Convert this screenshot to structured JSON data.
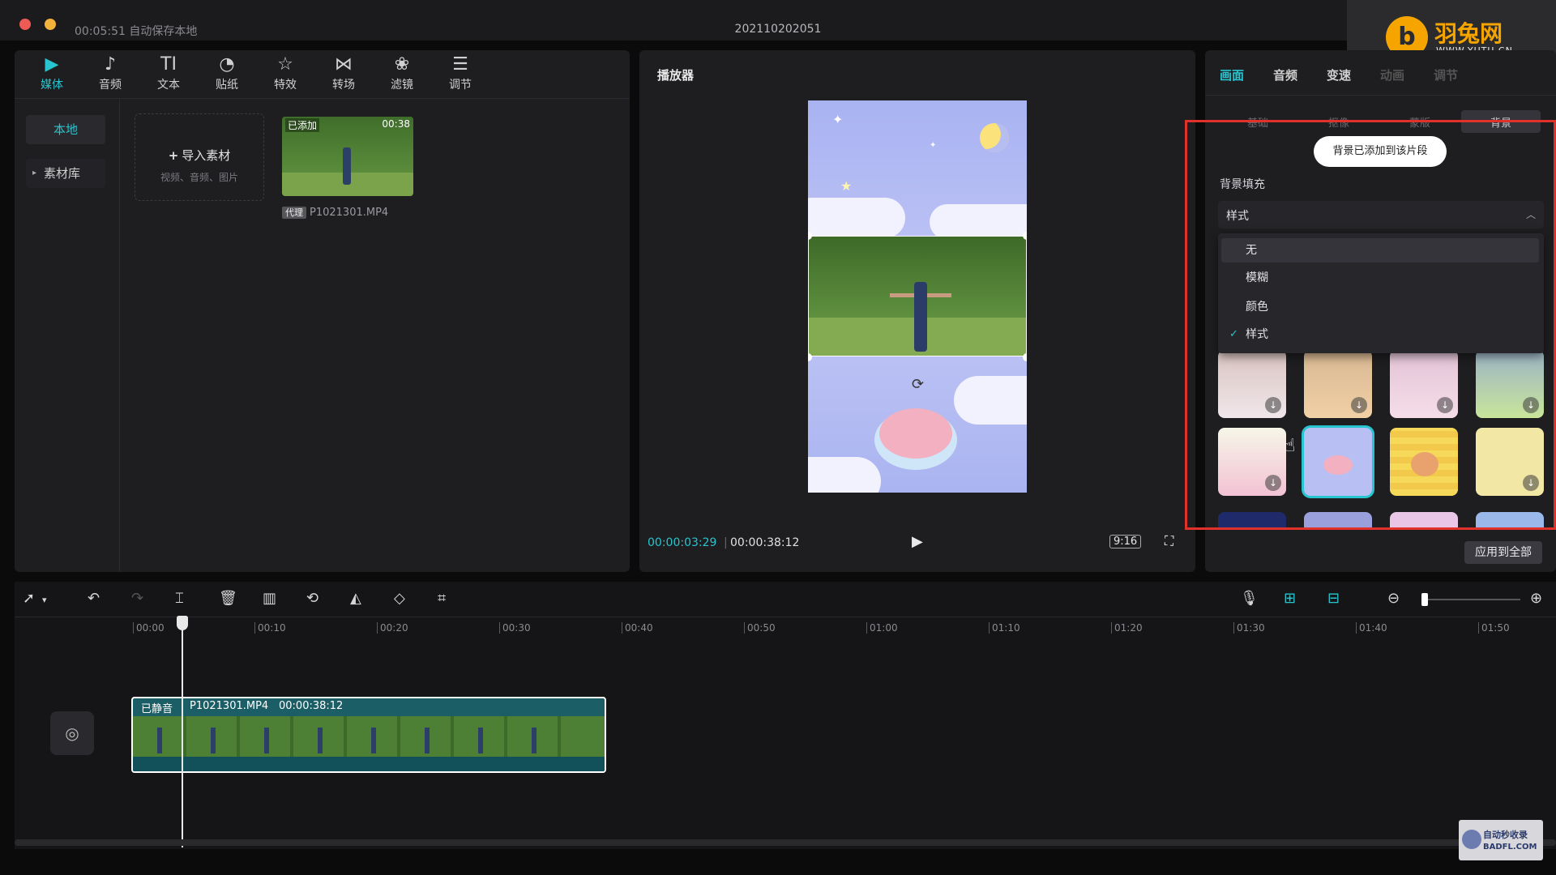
{
  "titlebar": {
    "autosave": "00:05:51 自动保存本地",
    "project_name": "202110202051"
  },
  "logo": {
    "mark": "b",
    "cn": "羽兔网",
    "en": "WWW.YUTU.CN"
  },
  "media": {
    "toolbar": [
      {
        "label": "媒体",
        "icon": "media-icon",
        "glyph": "▶",
        "active": true
      },
      {
        "label": "音频",
        "icon": "audio-icon",
        "glyph": "♪"
      },
      {
        "label": "文本",
        "icon": "text-icon",
        "glyph": "TI"
      },
      {
        "label": "贴纸",
        "icon": "sticker-icon",
        "glyph": "◔"
      },
      {
        "label": "特效",
        "icon": "effects-icon",
        "glyph": "☆"
      },
      {
        "label": "转场",
        "icon": "transition-icon",
        "glyph": "⋈"
      },
      {
        "label": "滤镜",
        "icon": "filter-icon",
        "glyph": "❀"
      },
      {
        "label": "调节",
        "icon": "adjust-icon",
        "glyph": "☰"
      }
    ],
    "side_local": "本地",
    "side_library": "素材库",
    "import_label": "导入素材",
    "import_plus": "+",
    "import_hint": "视频、音频、图片",
    "clip_added": "已添加",
    "clip_duration": "00:38",
    "clip_proxy": "代理",
    "clip_name": "P1021301.MP4"
  },
  "player": {
    "title": "播放器",
    "current_time": "00:00:03:29",
    "total_time": "00:00:38:12",
    "ratio": "9:16",
    "play_glyph": "▶",
    "fullscreen_glyph": "⛶",
    "rotate_glyph": "⟳"
  },
  "props": {
    "tabs": [
      "画面",
      "音频",
      "变速",
      "动画",
      "调节"
    ],
    "segments": [
      "基础",
      "抠像",
      "蒙版",
      "背景"
    ],
    "toast": "背景已添加到该片段",
    "section_title": "背景填充",
    "select_value": "样式",
    "select_caret": "︿",
    "dropdown": [
      "无",
      "模糊",
      "颜色",
      "样式"
    ],
    "check_glyph": "✓",
    "apply_all": "应用到全部",
    "accent": "#27c5cf"
  },
  "timeline": {
    "ticks": [
      "00:00",
      "00:10",
      "00:20",
      "00:30",
      "00:40",
      "00:50",
      "01:00",
      "01:10",
      "01:20",
      "01:30",
      "01:40",
      "01:50"
    ],
    "clip_muted": "已静音",
    "clip_name": "P1021301.MP4",
    "clip_duration": "00:00:38:12",
    "mute_glyph": "◎"
  },
  "watermark": {
    "line1": "自动秒收录",
    "line2": "BADFL.COM"
  }
}
